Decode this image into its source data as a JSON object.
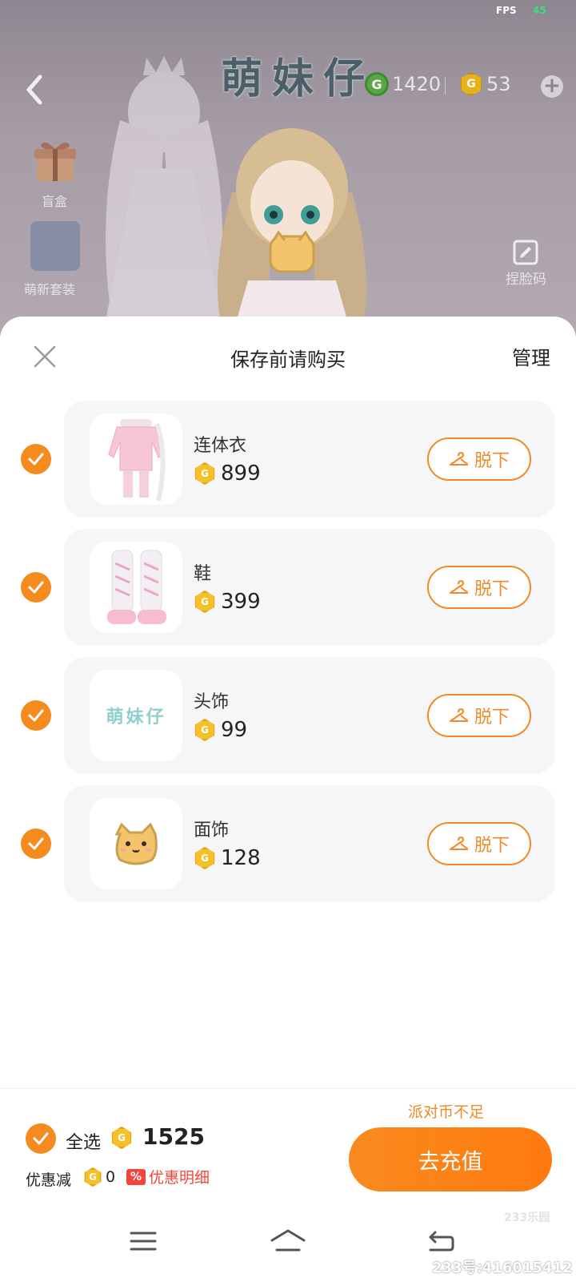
{
  "status": {
    "fps_label": "FPS",
    "fps_value": "45"
  },
  "game": {
    "logo": "萌妹仔",
    "green_currency": "1420",
    "gold_currency": "53",
    "side_buttons": {
      "gift_label": "盲盒",
      "avatar_label": "萌新套装",
      "face_label": "捏脸码"
    }
  },
  "sheet": {
    "title": "保存前请购买",
    "manage": "管理"
  },
  "items": [
    {
      "name": "连体衣",
      "price": "899",
      "action": "脱下"
    },
    {
      "name": "鞋",
      "price": "399",
      "action": "脱下"
    },
    {
      "name": "头饰",
      "price": "99",
      "action": "脱下",
      "thumb_text": "萌妹仔"
    },
    {
      "name": "面饰",
      "price": "128",
      "action": "脱下"
    }
  ],
  "footer": {
    "insufficient": "派对币不足",
    "select_all": "全选",
    "total": "1525",
    "discount_label": "优惠减",
    "discount_value": "0",
    "discount_badge": "%",
    "discount_detail": "优惠明细",
    "recharge": "去充值"
  },
  "watermark": {
    "logo": "233乐园",
    "id": "233号:416015412"
  },
  "colors": {
    "accent": "#f58a1f",
    "danger": "#f2453d",
    "scene": "#a69ca6"
  }
}
